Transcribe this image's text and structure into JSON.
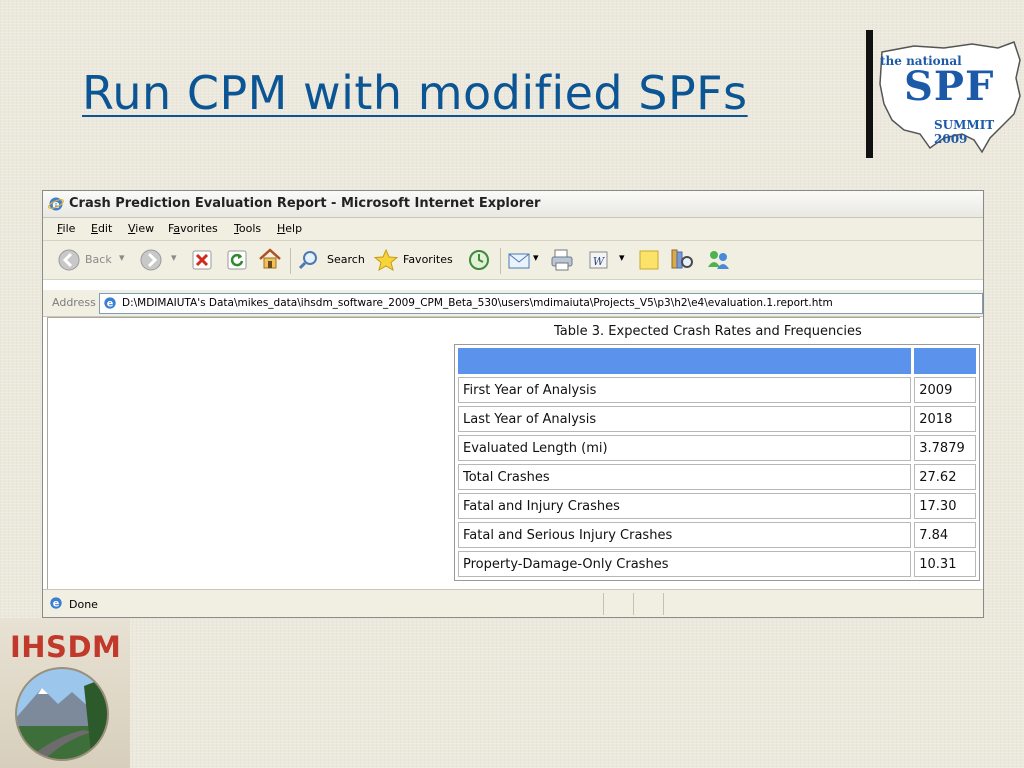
{
  "slide": {
    "title": "Run CPM with modified SPFs",
    "spf_logo": {
      "line1": "the national",
      "main": "SPF",
      "line3": "SUMMIT 2009"
    },
    "ihsdm_logo": {
      "text": "IHSDM"
    }
  },
  "window": {
    "title": "Crash Prediction Evaluation Report - Microsoft Internet Explorer",
    "menu": [
      {
        "pre": "",
        "u": "F",
        "post": "ile"
      },
      {
        "pre": "",
        "u": "E",
        "post": "dit"
      },
      {
        "pre": "",
        "u": "V",
        "post": "iew"
      },
      {
        "pre": "F",
        "u": "a",
        "post": "vorites"
      },
      {
        "pre": "",
        "u": "T",
        "post": "ools"
      },
      {
        "pre": "",
        "u": "H",
        "post": "elp"
      }
    ],
    "toolbar": {
      "back": "Back",
      "search": "Search",
      "favorites": "Favorites"
    },
    "address": {
      "label": "Address",
      "url": "D:\\MDIMAIUTA's Data\\mikes_data\\ihsdm_software_2009_CPM_Beta_530\\users\\mdimaiuta\\Projects_V5\\p3\\h2\\e4\\evaluation.1.report.htm"
    },
    "status": "Done"
  },
  "report": {
    "table_title": "Table 3.  Expected Crash Rates and Frequencies",
    "rows": [
      {
        "label": "First Year of Analysis",
        "value": "2009"
      },
      {
        "label": "Last Year of Analysis",
        "value": "2018"
      },
      {
        "label": "Evaluated Length (mi)",
        "value": "3.7879"
      },
      {
        "label": "Total Crashes",
        "value": "27.62"
      },
      {
        "label": "Fatal and Injury Crashes",
        "value": "17.30"
      },
      {
        "label": "Fatal and Serious Injury Crashes",
        "value": "7.84"
      },
      {
        "label": "Property-Damage-Only Crashes",
        "value": "10.31"
      }
    ]
  },
  "colors": {
    "title": "#0b5594",
    "header_row": "#5b93ec",
    "logo_blue": "#1c5aa8",
    "logo_red": "#c0392b"
  },
  "icons": [
    "ie-icon",
    "back-icon",
    "forward-icon",
    "stop-icon",
    "refresh-icon",
    "home-icon",
    "search-icon",
    "favorites-star-icon",
    "history-icon",
    "mail-icon",
    "print-icon",
    "word-icon",
    "note-icon",
    "research-icon",
    "messenger-icon"
  ]
}
